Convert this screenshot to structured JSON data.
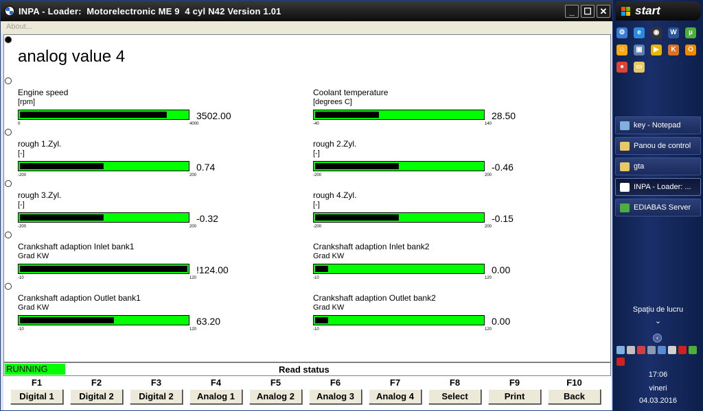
{
  "window": {
    "title": "INPA - Loader:  Motorelectronic ME 9  4 cyl N42 Version 1.01",
    "minimize_glyph": "_",
    "maximize_glyph": "☐",
    "close_glyph": "✕"
  },
  "menu": {
    "about": "About..."
  },
  "screen_title": "analog value 4",
  "gauges": [
    {
      "label": "Engine speed",
      "unit": "[rpm]",
      "value": "3502.00",
      "min": "0",
      "max": "4000",
      "fraction": 0.875
    },
    {
      "label": "Coolant temperature",
      "unit": "[degrees C]",
      "value": "28.50",
      "min": "-40",
      "max": "140",
      "fraction": 0.38
    },
    {
      "label": "rough 1.Zyl.",
      "unit": "[-]",
      "value": "0.74",
      "min": "-200",
      "max": "200",
      "fraction": 0.5
    },
    {
      "label": "rough 2.Zyl.",
      "unit": "[-]",
      "value": "-0.46",
      "min": "-200",
      "max": "200",
      "fraction": 0.5
    },
    {
      "label": "rough 3.Zyl.",
      "unit": "[-]",
      "value": "-0.32",
      "min": "-200",
      "max": "200",
      "fraction": 0.5
    },
    {
      "label": "rough 4.Zyl.",
      "unit": "[-]",
      "value": "-0.15",
      "min": "-200",
      "max": "200",
      "fraction": 0.5
    },
    {
      "label": "Crankshaft adaption Inlet bank1",
      "unit": "Grad KW",
      "value": "!124.00",
      "min": "-10",
      "max": "120",
      "fraction": 1.0
    },
    {
      "label": "Crankshaft adaption Inlet bank2",
      "unit": "Grad KW",
      "value": "0.00",
      "min": "-10",
      "max": "120",
      "fraction": 0.077
    },
    {
      "label": "Crankshaft adaption Outlet bank1",
      "unit": "Grad KW",
      "value": "63.20",
      "min": "-10",
      "max": "120",
      "fraction": 0.563
    },
    {
      "label": "Crankshaft adaption Outlet bank2",
      "unit": "Grad KW",
      "value": "0.00",
      "min": "-10",
      "max": "120",
      "fraction": 0.077
    }
  ],
  "status": {
    "running": "RUNNING",
    "read_status": "Read status"
  },
  "fkeys": [
    {
      "key": "F1",
      "label": "Digital 1"
    },
    {
      "key": "F2",
      "label": "Digital 2"
    },
    {
      "key": "F3",
      "label": "Digital 2"
    },
    {
      "key": "F4",
      "label": "Analog 1"
    },
    {
      "key": "F5",
      "label": "Analog 2"
    },
    {
      "key": "F6",
      "label": "Analog 3"
    },
    {
      "key": "F7",
      "label": "Analog 4"
    },
    {
      "key": "F8",
      "label": "Select"
    },
    {
      "key": "F9",
      "label": "Print"
    },
    {
      "key": "F10",
      "label": "Back"
    }
  ],
  "taskbar": {
    "start": "start",
    "quicklaunch": [
      {
        "name": "settings-icon",
        "color": "#3a7bd5",
        "glyph": "⚙"
      },
      {
        "name": "internet-explorer-icon",
        "color": "#2a8ae0",
        "glyph": "e"
      },
      {
        "name": "media-icon",
        "color": "#333333",
        "glyph": "◉"
      },
      {
        "name": "word-icon",
        "color": "#2b579a",
        "glyph": "W"
      },
      {
        "name": "utorrent-icon",
        "color": "#4caf3a",
        "glyph": "µ"
      },
      {
        "name": "emoticon-icon",
        "color": "#f3a915",
        "glyph": "☺"
      },
      {
        "name": "screen-icon",
        "color": "#5a7fb0",
        "glyph": "▣"
      },
      {
        "name": "player-icon",
        "color": "#e8b600",
        "glyph": "▶"
      },
      {
        "name": "kmplayer-icon",
        "color": "#e07020",
        "glyph": "K"
      },
      {
        "name": "odnoklassniki-icon",
        "color": "#f08a00",
        "glyph": "O"
      },
      {
        "name": "chrome-icon",
        "color": "#db4437",
        "glyph": "●"
      },
      {
        "name": "folder-icon",
        "color": "#e8c860",
        "glyph": "▭"
      }
    ],
    "tasks": [
      {
        "label": "key - Notepad",
        "icon": "notepad-icon",
        "color": "#7fb0e0"
      },
      {
        "label": "Panou de control",
        "icon": "control-panel-icon",
        "color": "#e8c860"
      },
      {
        "label": "gta",
        "icon": "folder-icon",
        "color": "#e8c860"
      },
      {
        "label": "INPA - Loader: ...",
        "icon": "bmw-icon",
        "color": "#ffffff"
      },
      {
        "label": "EDIABAS Server",
        "icon": "ediabas-icon",
        "color": "#4caf3a"
      }
    ],
    "desktop_label": "Spaţiu de lucru",
    "desktop_chevron": "⌄",
    "tray_toggle": "‹",
    "tray": [
      {
        "name": "network-icon",
        "color": "#7fb0e0"
      },
      {
        "name": "security-icon",
        "color": "#c0c0c0"
      },
      {
        "name": "help-icon",
        "color": "#d04040"
      },
      {
        "name": "usb-icon",
        "color": "#8a9ab0"
      },
      {
        "name": "battery-icon",
        "color": "#5a8ad0"
      },
      {
        "name": "display-icon",
        "color": "#d0d0d0"
      },
      {
        "name": "bitdefender-icon",
        "color": "#d02020"
      },
      {
        "name": "utorrent-tray-icon",
        "color": "#4caf3a"
      },
      {
        "name": "shield-icon",
        "color": "#d02020"
      }
    ],
    "time": "17:06",
    "day": "vineri",
    "date": "04.03.2016"
  }
}
